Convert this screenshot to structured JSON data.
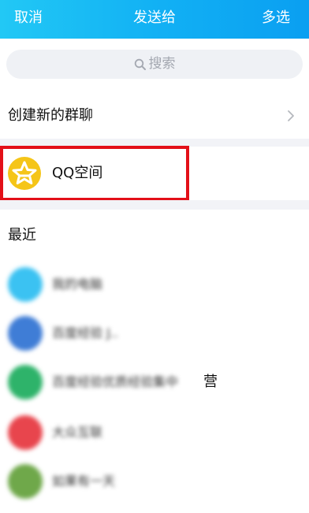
{
  "header": {
    "cancel_label": "取消",
    "title": "发送给",
    "multi_select_label": "多选"
  },
  "search": {
    "placeholder": "搜索",
    "icon": "search-icon"
  },
  "create_group": {
    "label": "创建新的群聊",
    "icon": "chevron-right-icon"
  },
  "qzone": {
    "label": "QQ空间",
    "icon": "qzone-star-icon",
    "icon_color": "#f5c518"
  },
  "recent": {
    "title": "最近",
    "contacts": [
      {
        "name": "我的电脑",
        "avatar_color": "#3bc2f2"
      },
      {
        "name": "百度经验 J..",
        "avatar_color": "#3f7dd6"
      },
      {
        "name": "百度经验优质经验集中",
        "tail": "营",
        "avatar_color": "#2eb36a"
      },
      {
        "name": "大众互联",
        "avatar_color": "#e8454d"
      },
      {
        "name": "如果有一天",
        "avatar_color": "#6fa84a"
      }
    ]
  },
  "colors": {
    "header_start": "#22c8f5",
    "header_end": "#0a9ff1",
    "highlight": "#e31018",
    "section_gap": "#f2f3f7"
  }
}
